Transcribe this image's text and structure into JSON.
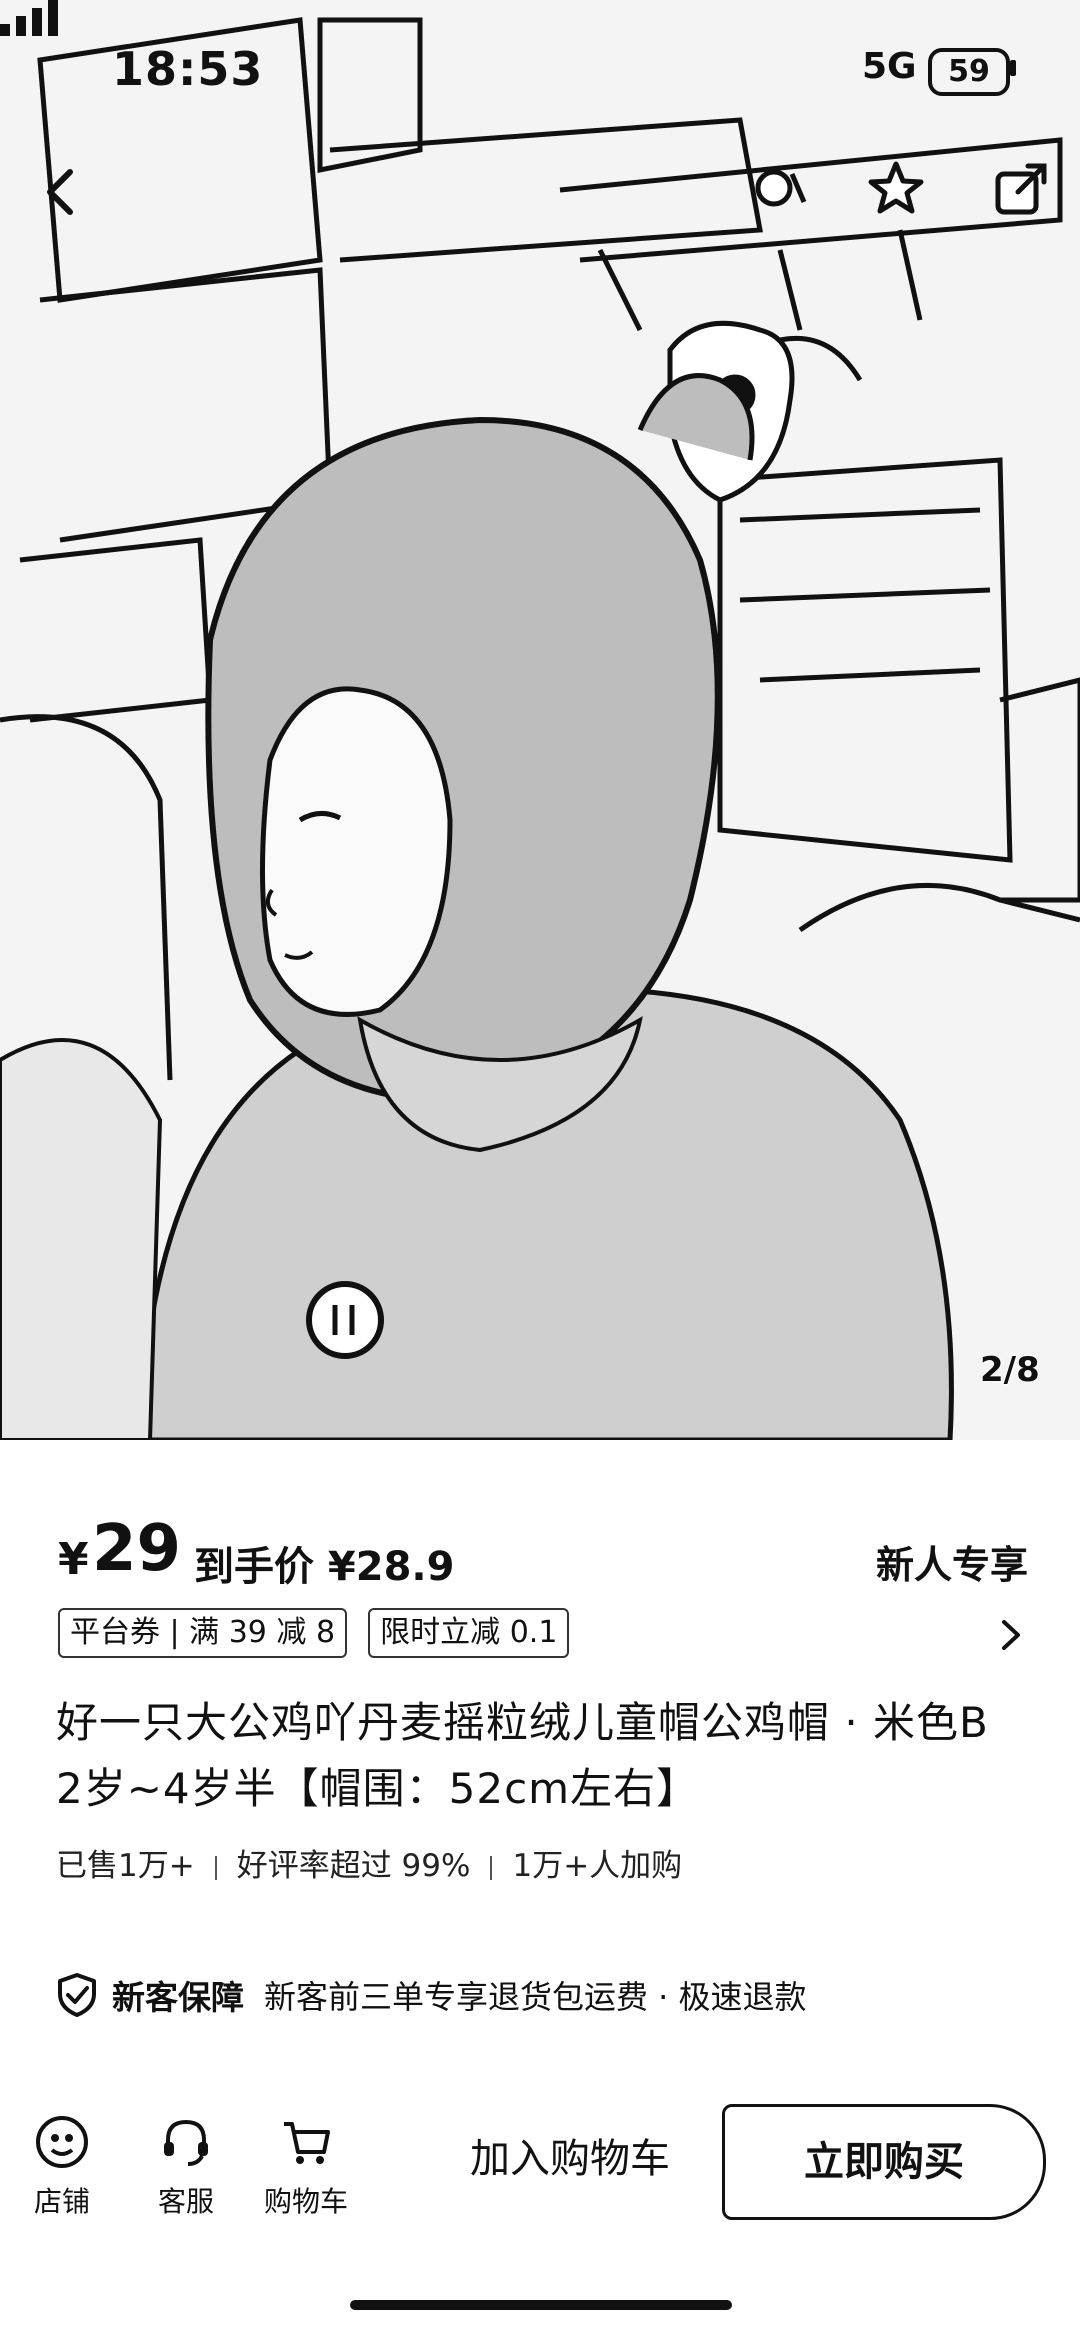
{
  "status_bar": {
    "time": "18:53",
    "network": "5G",
    "battery": "59"
  },
  "gallery": {
    "pager": "2/8"
  },
  "top_icons": [
    "back-icon",
    "brand-logo-icon",
    "favorite-star-icon",
    "share-icon"
  ],
  "price": {
    "currency": "¥",
    "amount": "29",
    "final_label": "到手价 ¥28.9",
    "newbie_label": "新人专享"
  },
  "tags": [
    "平台券 | 满 39 减 8",
    "限时立减 0.1"
  ],
  "product": {
    "title": "好一只大公鸡吖丹麦摇粒绒儿童帽公鸡帽 · 米色B 2岁~4岁半【帽围：52cm左右】",
    "stats": [
      "已售1万+",
      "好评率超过 99%",
      "1万+人加购"
    ]
  },
  "guarantee": {
    "title": "新客保障",
    "text": "新客前三单专享退货包运费 · 极速退款"
  },
  "bottom_bar": {
    "store_label": "店铺",
    "service_label": "客服",
    "cart_label": "购物车",
    "add_to_cart": "加入购物车",
    "buy_now": "立即购买"
  },
  "colors": {
    "text": "#111111",
    "background": "#ffffff"
  }
}
